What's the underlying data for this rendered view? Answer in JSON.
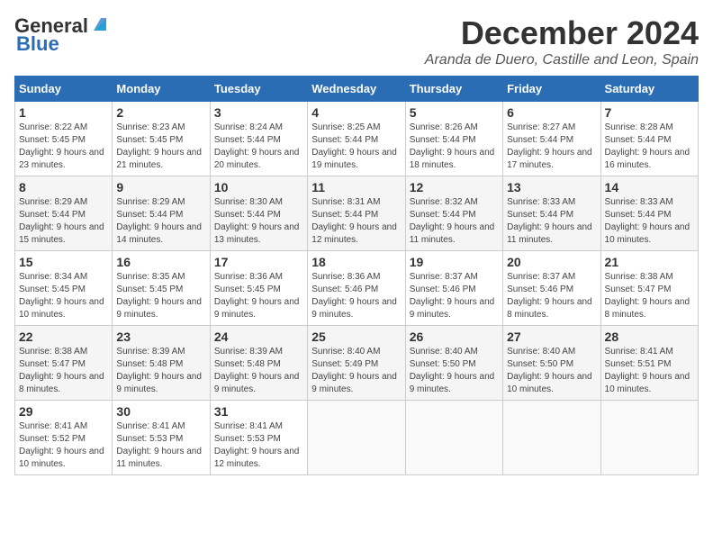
{
  "header": {
    "logo_line1": "General",
    "logo_line2": "Blue",
    "month": "December 2024",
    "location": "Aranda de Duero, Castille and Leon, Spain"
  },
  "weekdays": [
    "Sunday",
    "Monday",
    "Tuesday",
    "Wednesday",
    "Thursday",
    "Friday",
    "Saturday"
  ],
  "weeks": [
    [
      {
        "day": "1",
        "info": "Sunrise: 8:22 AM\nSunset: 5:45 PM\nDaylight: 9 hours and 23 minutes."
      },
      {
        "day": "2",
        "info": "Sunrise: 8:23 AM\nSunset: 5:45 PM\nDaylight: 9 hours and 21 minutes."
      },
      {
        "day": "3",
        "info": "Sunrise: 8:24 AM\nSunset: 5:44 PM\nDaylight: 9 hours and 20 minutes."
      },
      {
        "day": "4",
        "info": "Sunrise: 8:25 AM\nSunset: 5:44 PM\nDaylight: 9 hours and 19 minutes."
      },
      {
        "day": "5",
        "info": "Sunrise: 8:26 AM\nSunset: 5:44 PM\nDaylight: 9 hours and 18 minutes."
      },
      {
        "day": "6",
        "info": "Sunrise: 8:27 AM\nSunset: 5:44 PM\nDaylight: 9 hours and 17 minutes."
      },
      {
        "day": "7",
        "info": "Sunrise: 8:28 AM\nSunset: 5:44 PM\nDaylight: 9 hours and 16 minutes."
      }
    ],
    [
      {
        "day": "8",
        "info": "Sunrise: 8:29 AM\nSunset: 5:44 PM\nDaylight: 9 hours and 15 minutes."
      },
      {
        "day": "9",
        "info": "Sunrise: 8:29 AM\nSunset: 5:44 PM\nDaylight: 9 hours and 14 minutes."
      },
      {
        "day": "10",
        "info": "Sunrise: 8:30 AM\nSunset: 5:44 PM\nDaylight: 9 hours and 13 minutes."
      },
      {
        "day": "11",
        "info": "Sunrise: 8:31 AM\nSunset: 5:44 PM\nDaylight: 9 hours and 12 minutes."
      },
      {
        "day": "12",
        "info": "Sunrise: 8:32 AM\nSunset: 5:44 PM\nDaylight: 9 hours and 11 minutes."
      },
      {
        "day": "13",
        "info": "Sunrise: 8:33 AM\nSunset: 5:44 PM\nDaylight: 9 hours and 11 minutes."
      },
      {
        "day": "14",
        "info": "Sunrise: 8:33 AM\nSunset: 5:44 PM\nDaylight: 9 hours and 10 minutes."
      }
    ],
    [
      {
        "day": "15",
        "info": "Sunrise: 8:34 AM\nSunset: 5:45 PM\nDaylight: 9 hours and 10 minutes."
      },
      {
        "day": "16",
        "info": "Sunrise: 8:35 AM\nSunset: 5:45 PM\nDaylight: 9 hours and 9 minutes."
      },
      {
        "day": "17",
        "info": "Sunrise: 8:36 AM\nSunset: 5:45 PM\nDaylight: 9 hours and 9 minutes."
      },
      {
        "day": "18",
        "info": "Sunrise: 8:36 AM\nSunset: 5:46 PM\nDaylight: 9 hours and 9 minutes."
      },
      {
        "day": "19",
        "info": "Sunrise: 8:37 AM\nSunset: 5:46 PM\nDaylight: 9 hours and 9 minutes."
      },
      {
        "day": "20",
        "info": "Sunrise: 8:37 AM\nSunset: 5:46 PM\nDaylight: 9 hours and 8 minutes."
      },
      {
        "day": "21",
        "info": "Sunrise: 8:38 AM\nSunset: 5:47 PM\nDaylight: 9 hours and 8 minutes."
      }
    ],
    [
      {
        "day": "22",
        "info": "Sunrise: 8:38 AM\nSunset: 5:47 PM\nDaylight: 9 hours and 8 minutes."
      },
      {
        "day": "23",
        "info": "Sunrise: 8:39 AM\nSunset: 5:48 PM\nDaylight: 9 hours and 9 minutes."
      },
      {
        "day": "24",
        "info": "Sunrise: 8:39 AM\nSunset: 5:48 PM\nDaylight: 9 hours and 9 minutes."
      },
      {
        "day": "25",
        "info": "Sunrise: 8:40 AM\nSunset: 5:49 PM\nDaylight: 9 hours and 9 minutes."
      },
      {
        "day": "26",
        "info": "Sunrise: 8:40 AM\nSunset: 5:50 PM\nDaylight: 9 hours and 9 minutes."
      },
      {
        "day": "27",
        "info": "Sunrise: 8:40 AM\nSunset: 5:50 PM\nDaylight: 9 hours and 10 minutes."
      },
      {
        "day": "28",
        "info": "Sunrise: 8:41 AM\nSunset: 5:51 PM\nDaylight: 9 hours and 10 minutes."
      }
    ],
    [
      {
        "day": "29",
        "info": "Sunrise: 8:41 AM\nSunset: 5:52 PM\nDaylight: 9 hours and 10 minutes."
      },
      {
        "day": "30",
        "info": "Sunrise: 8:41 AM\nSunset: 5:53 PM\nDaylight: 9 hours and 11 minutes."
      },
      {
        "day": "31",
        "info": "Sunrise: 8:41 AM\nSunset: 5:53 PM\nDaylight: 9 hours and 12 minutes."
      },
      null,
      null,
      null,
      null
    ]
  ]
}
